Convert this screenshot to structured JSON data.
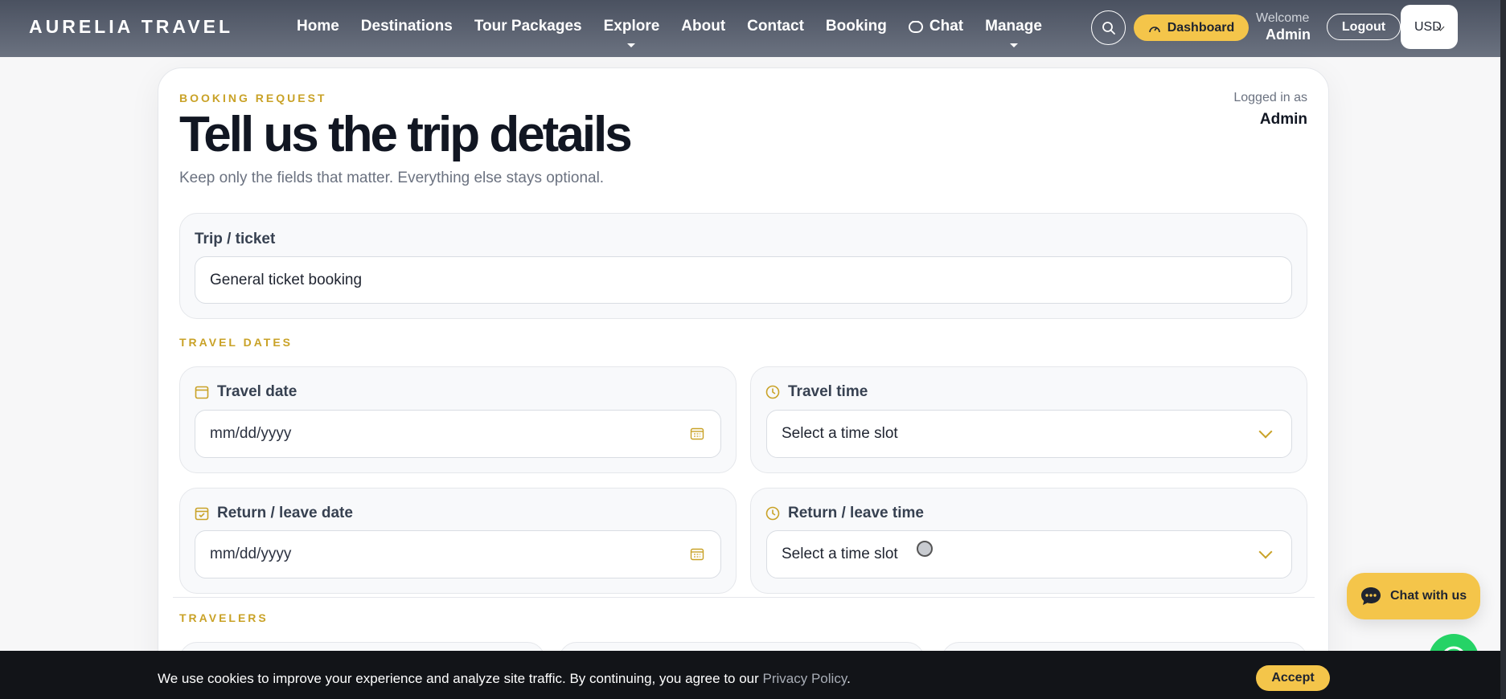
{
  "brand": "AURELIA TRAVEL",
  "nav": {
    "home": "Home",
    "destinations": "Destinations",
    "tours": "Tour Packages",
    "explore": "Explore",
    "about": "About",
    "contact": "Contact",
    "booking": "Booking",
    "chat": "Chat",
    "manage": "Manage"
  },
  "header": {
    "dashboard_label": "Dashboard",
    "welcome_label": "Welcome",
    "welcome_user": "Admin",
    "logout_label": "Logout",
    "currency": "USD"
  },
  "page": {
    "eyebrow": "BOOKING REQUEST",
    "title": "Tell us the trip details",
    "subtitle": "Keep only the fields that matter. Everything else stays optional.",
    "logged_label": "Logged in as",
    "logged_user": "Admin"
  },
  "trip": {
    "label": "Trip / ticket",
    "value": "General ticket booking"
  },
  "dates_section": "TRAVEL DATES",
  "travel_date": {
    "label": "Travel date",
    "placeholder": "mm/dd/yyyy"
  },
  "travel_time": {
    "label": "Travel time",
    "placeholder": "Select a time slot"
  },
  "return_date": {
    "label": "Return / leave date",
    "placeholder": "mm/dd/yyyy"
  },
  "return_time": {
    "label": "Return / leave time",
    "placeholder": "Select a time slot"
  },
  "travelers_section": "TRAVELERS",
  "chat_widget": {
    "label": "Chat with us"
  },
  "cookie": {
    "text": "We use cookies to improve your experience and analyze site traffic. By continuing, you agree to our",
    "link": "Privacy Policy",
    "period": ".",
    "accept": "Accept"
  },
  "colors": {
    "accent": "#f4c54a",
    "gold_text": "#c9a227",
    "nav_bg": "#5a606c"
  },
  "icons": [
    "search-icon",
    "dashboard-icon",
    "chat-icon",
    "calendar-icon",
    "clock-icon",
    "chevron-down-icon",
    "whatsapp-icon"
  ]
}
